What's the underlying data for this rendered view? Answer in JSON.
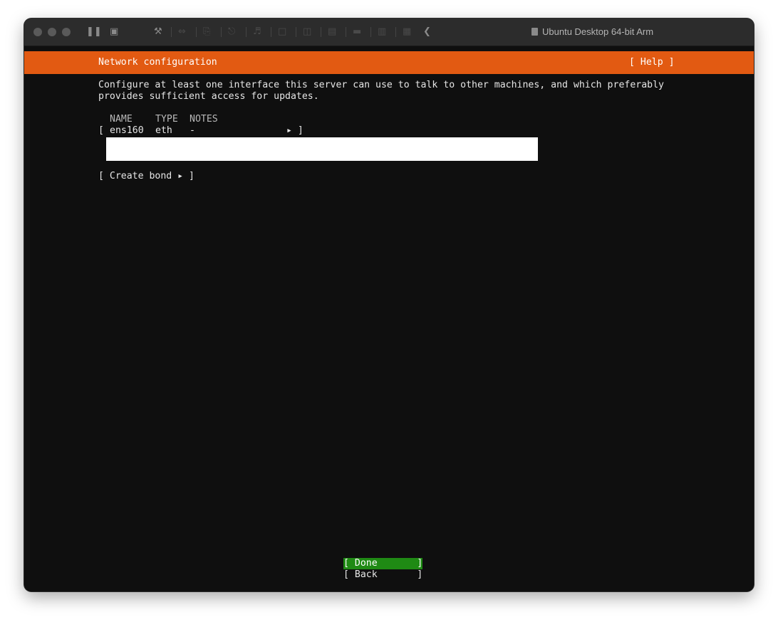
{
  "window": {
    "title": "Ubuntu Desktop 64-bit Arm",
    "toolbar_icons": [
      "pause-icon",
      "snapshot-icon",
      "wrench-icon",
      "network-icon",
      "printer-icon",
      "usb-icon",
      "audio-icon",
      "camera-icon",
      "disk-icon",
      "drive-icon",
      "cable-icon",
      "fullscreen-icon",
      "back-icon"
    ]
  },
  "installer": {
    "header_title": "Network configuration",
    "help_button": "[ Help ]",
    "description_line1": "Configure at least one interface this server can use to talk to other machines, and which preferably",
    "description_line2": "provides sufficient access for updates.",
    "columns": {
      "name": "NAME",
      "type": "TYPE",
      "notes": "NOTES"
    },
    "interfaces": [
      {
        "bracket_open": "[",
        "name": "ens160",
        "type": "eth",
        "notes": "-",
        "arrow": "▸ ]"
      }
    ],
    "create_bond": "[ Create bond ▸ ]",
    "done_button": "[ Done       ]",
    "back_button": "[ Back       ]"
  },
  "colors": {
    "header_bg": "#e25a12",
    "terminal_bg": "#0f0f0f",
    "done_bg": "#1f8a14"
  }
}
